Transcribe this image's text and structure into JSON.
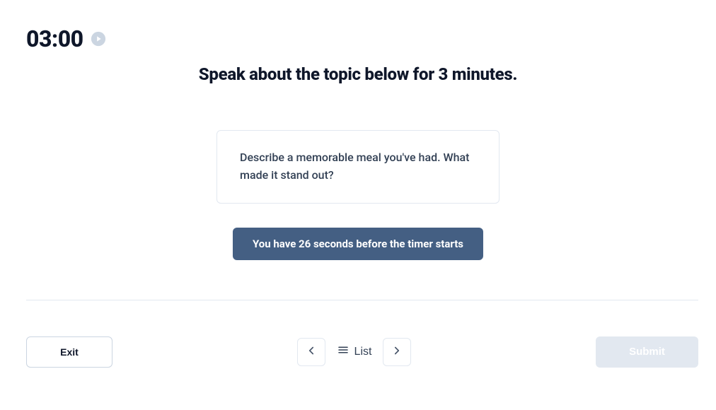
{
  "timer": {
    "value": "03:00"
  },
  "instruction": "Speak about the topic below for 3 minutes.",
  "topic": {
    "prompt": "Describe a memorable meal you've had. What made it stand out?"
  },
  "countdown": {
    "message": "You have 26 seconds before the timer starts"
  },
  "footer": {
    "exit_label": "Exit",
    "list_label": "List",
    "submit_label": "Submit"
  }
}
